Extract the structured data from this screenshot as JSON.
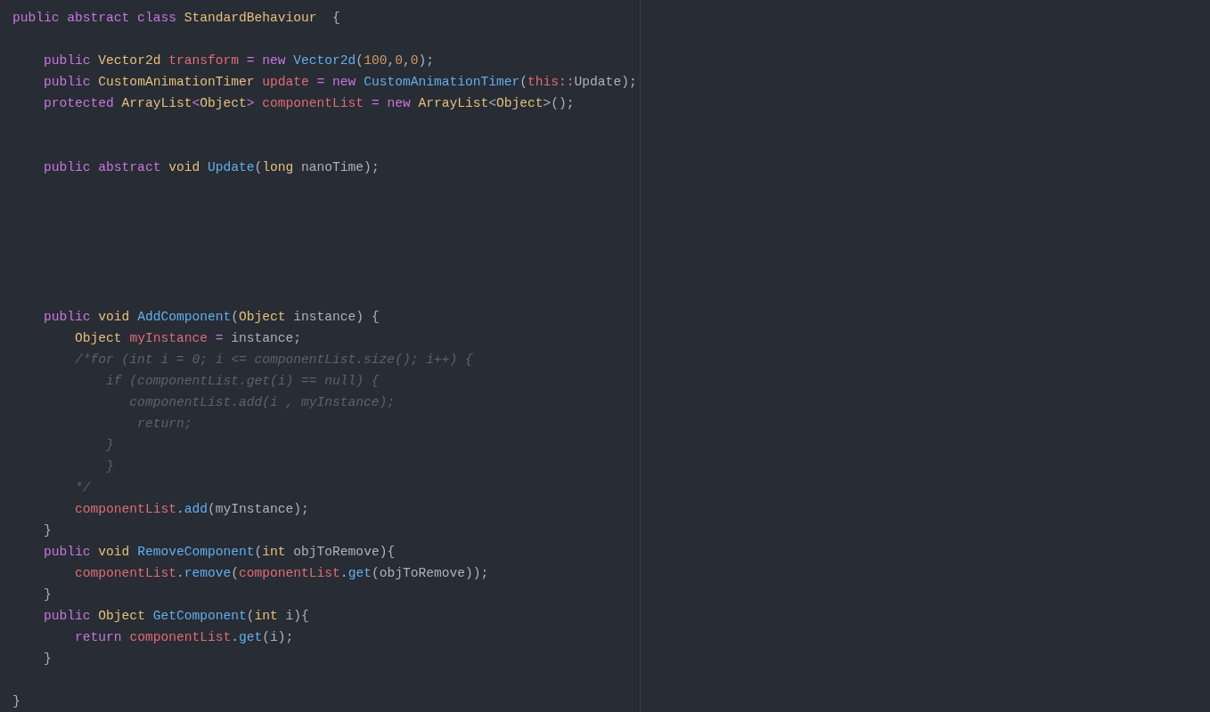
{
  "editor": {
    "lines": [
      {
        "kind": "code",
        "tokens": [
          {
            "kind": "keyword",
            "text": "public abstract class "
          },
          {
            "kind": "type",
            "text": "StandardBehaviour  "
          },
          {
            "kind": "plain",
            "text": "{"
          }
        ]
      },
      {
        "kind": "blank"
      },
      {
        "kind": "code",
        "tokens": [
          {
            "kind": "keyword",
            "text": "    public "
          },
          {
            "kind": "type",
            "text": "Vector2d "
          },
          {
            "kind": "variable",
            "text": "transform "
          },
          {
            "kind": "operator",
            "text": "= "
          },
          {
            "kind": "keyword",
            "text": "new "
          },
          {
            "kind": "function",
            "text": "Vector2d"
          },
          {
            "kind": "plain",
            "text": "("
          },
          {
            "kind": "number",
            "text": "100"
          },
          {
            "kind": "plain",
            "text": ","
          },
          {
            "kind": "number",
            "text": "0"
          },
          {
            "kind": "plain",
            "text": ","
          },
          {
            "kind": "number",
            "text": "0"
          },
          {
            "kind": "plain",
            "text": ");"
          }
        ]
      },
      {
        "kind": "code",
        "tokens": [
          {
            "kind": "keyword",
            "text": "    public "
          },
          {
            "kind": "type",
            "text": "CustomAnimationTimer "
          },
          {
            "kind": "variable",
            "text": "update "
          },
          {
            "kind": "operator",
            "text": "= "
          },
          {
            "kind": "keyword",
            "text": "new "
          },
          {
            "kind": "function",
            "text": "CustomAnimationTimer"
          },
          {
            "kind": "plain",
            "text": "("
          },
          {
            "kind": "variable",
            "text": "this"
          },
          {
            "kind": "operator",
            "text": "::"
          },
          {
            "kind": "plain",
            "text": "Update);"
          }
        ]
      },
      {
        "kind": "code",
        "tokens": [
          {
            "kind": "keyword",
            "text": "    protected "
          },
          {
            "kind": "type",
            "text": "ArrayList"
          },
          {
            "kind": "operator",
            "text": "<"
          },
          {
            "kind": "type",
            "text": "Object"
          },
          {
            "kind": "operator",
            "text": "> "
          },
          {
            "kind": "variable",
            "text": "componentList "
          },
          {
            "kind": "operator",
            "text": "= "
          },
          {
            "kind": "keyword",
            "text": "new "
          },
          {
            "kind": "type",
            "text": "ArrayList"
          },
          {
            "kind": "plain",
            "text": "<"
          },
          {
            "kind": "type",
            "text": "Object"
          },
          {
            "kind": "plain",
            "text": ">();"
          }
        ]
      },
      {
        "kind": "blank"
      },
      {
        "kind": "blank"
      },
      {
        "kind": "code",
        "tokens": [
          {
            "kind": "keyword",
            "text": "    public abstract "
          },
          {
            "kind": "type",
            "text": "void "
          },
          {
            "kind": "function",
            "text": "Update"
          },
          {
            "kind": "plain",
            "text": "("
          },
          {
            "kind": "type",
            "text": "long "
          },
          {
            "kind": "plain",
            "text": "nanoTime);"
          }
        ]
      },
      {
        "kind": "blank"
      },
      {
        "kind": "blank"
      },
      {
        "kind": "blank"
      },
      {
        "kind": "blank"
      },
      {
        "kind": "blank"
      },
      {
        "kind": "blank"
      },
      {
        "kind": "code",
        "tokens": [
          {
            "kind": "keyword",
            "text": "    public "
          },
          {
            "kind": "type",
            "text": "void "
          },
          {
            "kind": "function",
            "text": "AddComponent"
          },
          {
            "kind": "plain",
            "text": "("
          },
          {
            "kind": "type",
            "text": "Object "
          },
          {
            "kind": "plain",
            "text": "instance) {"
          }
        ]
      },
      {
        "kind": "code",
        "tokens": [
          {
            "kind": "type",
            "text": "        Object "
          },
          {
            "kind": "variable",
            "text": "myInstance "
          },
          {
            "kind": "operator",
            "text": "= "
          },
          {
            "kind": "plain",
            "text": "instance;"
          }
        ]
      },
      {
        "kind": "code",
        "tokens": [
          {
            "kind": "comment",
            "text": "        /*for (int i = 0; i <= componentList.size(); i++) {"
          }
        ]
      },
      {
        "kind": "code",
        "tokens": [
          {
            "kind": "comment",
            "text": "            if (componentList.get(i) == null) {"
          }
        ]
      },
      {
        "kind": "code",
        "tokens": [
          {
            "kind": "comment",
            "text": "               componentList.add(i , myInstance);"
          }
        ]
      },
      {
        "kind": "code",
        "tokens": [
          {
            "kind": "comment",
            "text": "                return;"
          }
        ]
      },
      {
        "kind": "code",
        "tokens": [
          {
            "kind": "comment",
            "text": "            }"
          }
        ]
      },
      {
        "kind": "code",
        "tokens": [
          {
            "kind": "comment",
            "text": "            }"
          }
        ]
      },
      {
        "kind": "code",
        "tokens": [
          {
            "kind": "comment",
            "text": "        */"
          }
        ]
      },
      {
        "kind": "code",
        "tokens": [
          {
            "kind": "variable",
            "text": "        componentList"
          },
          {
            "kind": "plain",
            "text": "."
          },
          {
            "kind": "function",
            "text": "add"
          },
          {
            "kind": "plain",
            "text": "(myInstance);"
          }
        ]
      },
      {
        "kind": "code",
        "tokens": [
          {
            "kind": "plain",
            "text": "    }"
          }
        ]
      },
      {
        "kind": "code",
        "tokens": [
          {
            "kind": "keyword",
            "text": "    public "
          },
          {
            "kind": "type",
            "text": "void "
          },
          {
            "kind": "function",
            "text": "RemoveComponent"
          },
          {
            "kind": "plain",
            "text": "("
          },
          {
            "kind": "type",
            "text": "int "
          },
          {
            "kind": "plain",
            "text": "objToRemove){"
          }
        ]
      },
      {
        "kind": "code",
        "tokens": [
          {
            "kind": "variable",
            "text": "        componentList"
          },
          {
            "kind": "plain",
            "text": "."
          },
          {
            "kind": "function",
            "text": "remove"
          },
          {
            "kind": "plain",
            "text": "("
          },
          {
            "kind": "variable",
            "text": "componentList"
          },
          {
            "kind": "plain",
            "text": "."
          },
          {
            "kind": "function",
            "text": "get"
          },
          {
            "kind": "plain",
            "text": "(objToRemove));"
          }
        ]
      },
      {
        "kind": "code",
        "tokens": [
          {
            "kind": "plain",
            "text": "    }"
          }
        ]
      },
      {
        "kind": "code",
        "tokens": [
          {
            "kind": "keyword",
            "text": "    public "
          },
          {
            "kind": "type",
            "text": "Object "
          },
          {
            "kind": "function",
            "text": "GetComponent"
          },
          {
            "kind": "plain",
            "text": "("
          },
          {
            "kind": "type",
            "text": "int "
          },
          {
            "kind": "plain",
            "text": "i){"
          }
        ]
      },
      {
        "kind": "code",
        "tokens": [
          {
            "kind": "keyword",
            "text": "        return "
          },
          {
            "kind": "variable",
            "text": "componentList"
          },
          {
            "kind": "plain",
            "text": "."
          },
          {
            "kind": "function",
            "text": "get"
          },
          {
            "kind": "plain",
            "text": "(i);"
          }
        ]
      },
      {
        "kind": "code",
        "tokens": [
          {
            "kind": "plain",
            "text": "    }"
          }
        ]
      },
      {
        "kind": "blank"
      },
      {
        "kind": "code",
        "tokens": [
          {
            "kind": "plain",
            "text": "}"
          }
        ]
      }
    ]
  }
}
